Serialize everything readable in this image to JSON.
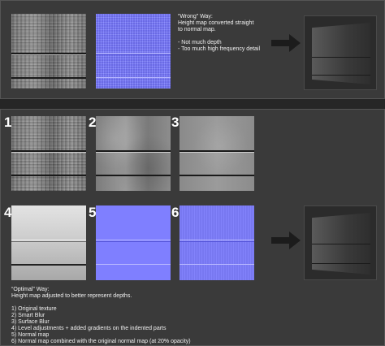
{
  "wrong": {
    "title": "“Wrong” Way:",
    "lines": [
      "Height map converted straight",
      "to normal map.",
      "",
      "- Not much depth",
      "- Too much high frequency detail"
    ]
  },
  "steps": [
    {
      "number": "1"
    },
    {
      "number": "2"
    },
    {
      "number": "3"
    },
    {
      "number": "4"
    },
    {
      "number": "5"
    },
    {
      "number": "6"
    }
  ],
  "optimal": {
    "title": "“Optimal” Way:",
    "subtitle": "Height map adjusted to better represent depths.",
    "items": [
      "1) Original texture",
      "2) Smart Blur",
      "3) Surface Blur",
      "4) Level adjustments + added gradients on the indented parts",
      "5) Normal map",
      "6) Normal map combined with the original normal map (at 20% opacity)"
    ]
  },
  "colors": {
    "background": "#262626",
    "panel": "#3a3a3a",
    "normal_map_blue": "#7f7fff",
    "arrow": "#1c1c1c"
  },
  "icons": {
    "arrow": "right-arrow-icon"
  }
}
